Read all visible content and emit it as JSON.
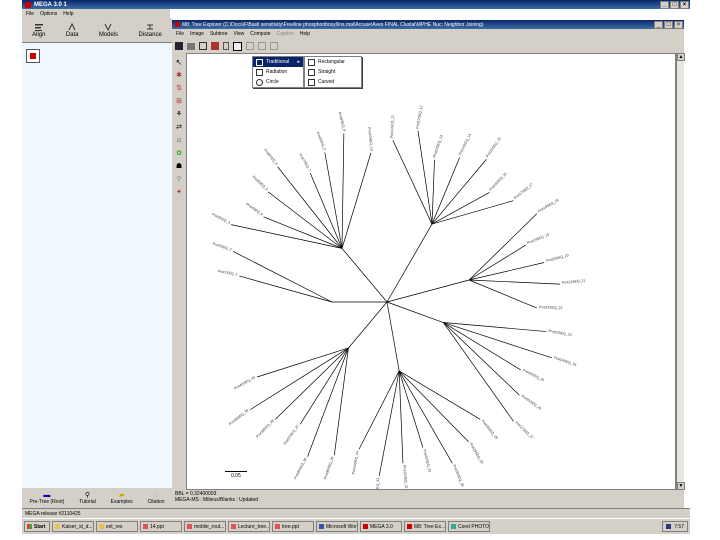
{
  "outer": {
    "title": "MEGA 3.0 1",
    "menu": [
      "File",
      "Options",
      "Help"
    ],
    "toolbar": [
      {
        "label": "Align",
        "icon": "align-icon"
      },
      {
        "label": "Data",
        "icon": "data-icon"
      },
      {
        "label": "Models",
        "icon": "models-icon"
      },
      {
        "label": "Distance",
        "icon": "distance-icon"
      }
    ],
    "bottom_buttons": [
      {
        "label": "Pre-Tree (Root)",
        "icon": "pre-tree-icon"
      },
      {
        "label": "Tutorial",
        "icon": "tutorial-icon"
      },
      {
        "label": "Examples",
        "icon": "examples-icon"
      },
      {
        "label": "Citation",
        "icon": "citation-icon"
      }
    ],
    "status": "MEGA release #2110425"
  },
  "tree_window": {
    "title": "M8: Tree Explorer (C:\\Docs\\F\\Basil sensitivity\\Freeline phosphoribosyl\\ins.mal\\Arcuse\\Aves FINAL Clustal\\MPHE Nuc: Neighbor Joining)",
    "menu": [
      "File",
      "Image",
      "Subtree",
      "View",
      "Compute",
      "Caption",
      "Help"
    ],
    "status_left": "BBL = 0.32400003",
    "status_right": "MEGA-MS : Milieus/Blanks : Updated"
  },
  "view_menu": {
    "items": [
      {
        "label": "Traditional",
        "icon": "traditional-tree-icon",
        "submenu": true
      },
      {
        "label": "Radiation",
        "icon": "radiation-tree-icon",
        "submenu": false
      },
      {
        "label": "Circle",
        "icon": "circle-tree-icon",
        "submenu": false
      }
    ],
    "submenu_items": [
      {
        "label": "Rectangular",
        "icon": "rectangular-icon"
      },
      {
        "label": "Straight",
        "icon": "straight-icon"
      },
      {
        "label": "Curved",
        "icon": "curved-icon"
      }
    ]
  },
  "scale_bar": "0.05",
  "leaf_labels": [
    "Prot1SEQ_1",
    "Prot2SEQ_2",
    "Prot3SEQ_3",
    "Prot4SEQ_4",
    "Prot5SEQ_5",
    "Prot6SEQ_6",
    "Prot7SEQ_7",
    "Prot8SEQ_8",
    "Prot9SEQ_9",
    "Prot10SEQ_10",
    "Prot11SEQ_11",
    "Prot12SEQ_12",
    "Prot13SEQ_13",
    "Prot14SEQ_14",
    "Prot15SEQ_15",
    "Prot16SEQ_16",
    "Prot17SEQ_17",
    "Prot18SEQ_18",
    "Prot19SEQ_19",
    "Prot20SEQ_20",
    "Prot21SEQ_21",
    "Prot22SEQ_22",
    "Prot23SEQ_23",
    "Prot24SEQ_24",
    "Prot25SEQ_25",
    "Prot26SEQ_26",
    "Prot27SEQ_27",
    "Prot28SEQ_28",
    "Prot29SEQ_29",
    "Prot30SEQ_30",
    "Prot31SEQ_31",
    "Prot32SEQ_32",
    "Prot33SEQ_33",
    "Prot34SEQ_34",
    "Prot35SEQ_35",
    "Prot36SEQ_36",
    "Prot37SEQ_37",
    "Prot38SEQ_38",
    "Prot39SEQ_39",
    "Prot40SEQ_40"
  ],
  "taskbar": {
    "start": "Start",
    "items": [
      {
        "label": "Kaiser_st_d...",
        "icon": "folder-icon"
      },
      {
        "label": "ext_res",
        "icon": "folder-icon"
      },
      {
        "label": "14.ppt",
        "icon": "ppt-icon"
      },
      {
        "label": "mobile_rout...",
        "icon": "ppt-icon"
      },
      {
        "label": "Lecture_tree...",
        "icon": "ppt-icon"
      },
      {
        "label": "tree.ppt",
        "icon": "ppt-icon"
      },
      {
        "label": "Microsoft Word",
        "icon": "word-icon"
      },
      {
        "label": "MEGA 3.0",
        "icon": "mega-icon"
      },
      {
        "label": "M8: Tree Ex...",
        "icon": "mega-icon"
      },
      {
        "label": "Corel PHOTO...",
        "icon": "corel-icon"
      }
    ],
    "clock": "7:57"
  },
  "colors": {
    "title_bar": "#0a246a",
    "chrome": "#d4d0c8",
    "selection": "#0a246a"
  }
}
